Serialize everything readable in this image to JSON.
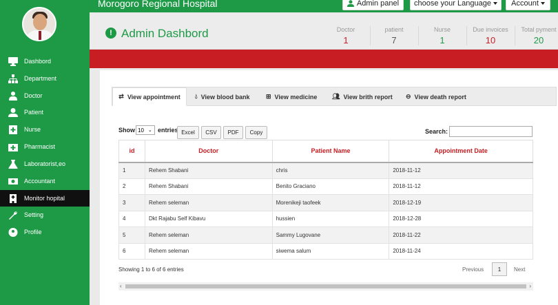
{
  "app": {
    "hospital_name": "Morogoro Regional Hospital"
  },
  "topbar": {
    "admin_panel": "Admin panel",
    "language": "choose your Language",
    "account": "Account"
  },
  "sidebar": {
    "items": [
      {
        "label": "Dashbord",
        "icon": "monitor-icon"
      },
      {
        "label": "Department",
        "icon": "sitemap-icon"
      },
      {
        "label": "Doctor",
        "icon": "doctor-icon"
      },
      {
        "label": "Patient",
        "icon": "user-icon"
      },
      {
        "label": "Nurse",
        "icon": "plus-square-icon"
      },
      {
        "label": "Pharmacist",
        "icon": "medkit-icon"
      },
      {
        "label": "Laboratorist,eo",
        "icon": "flask-icon"
      },
      {
        "label": "Accountant",
        "icon": "money-icon"
      },
      {
        "label": "Monitor hopital",
        "icon": "hospital-icon",
        "active": true
      },
      {
        "label": "Setting",
        "icon": "wrench-icon"
      },
      {
        "label": "Profile",
        "icon": "user-circle-icon"
      }
    ]
  },
  "header": {
    "title": "Admin Dashbord",
    "stats": [
      {
        "label": "Doctor",
        "value": "1",
        "color": "#c81d22"
      },
      {
        "label": "patient",
        "value": "7",
        "color": "#555555"
      },
      {
        "label": "Nurse",
        "value": "1",
        "color": "#1e9a47"
      },
      {
        "label": "Due invoices",
        "value": "10",
        "color": "#c81d22"
      },
      {
        "label": "Total pyment",
        "value": "20",
        "color": "#1e9a47"
      }
    ]
  },
  "tabs": [
    {
      "label": "View appointment",
      "icon": "exchange-icon",
      "active": true
    },
    {
      "label": "View blood bank",
      "icon": "drop-icon"
    },
    {
      "label": "View medicine",
      "icon": "plus-square-icon"
    },
    {
      "label": "View brith report",
      "icon": "users-icon"
    },
    {
      "label": "View death report",
      "icon": "minus-circle-icon"
    }
  ],
  "table_controls": {
    "show": "Show",
    "entries_value": "10",
    "entries": "entries",
    "buttons": [
      "Excel",
      "CSV",
      "PDF",
      "Copy"
    ],
    "search_label": "Search:"
  },
  "table": {
    "columns": [
      "id",
      "Doctor",
      "Patient Name",
      "Appointment Date"
    ],
    "rows": [
      [
        "1",
        "Rehem Shabani",
        "chris",
        "2018-11-12"
      ],
      [
        "2",
        "Rehem Shabani",
        "Benito Graciano",
        "2018-11-12"
      ],
      [
        "3",
        "Rehem seleman",
        "Morenikeji taofeek",
        "2018-12-19"
      ],
      [
        "4",
        "Dkt Rajabu Self Kibavu",
        "hussien",
        "2018-12-28"
      ],
      [
        "5",
        "Rehem seleman",
        "Sammy Lugovane",
        "2018-11-22"
      ],
      [
        "6",
        "Rehem seleman",
        "siwema salum",
        "2018-11-24"
      ]
    ]
  },
  "pagination": {
    "info": "Showing 1 to 6 of 6 entries",
    "previous": "Previous",
    "page": "1",
    "next": "Next"
  },
  "colors": {
    "brand_green": "#1e9a47",
    "accent_red": "#c81d22"
  }
}
